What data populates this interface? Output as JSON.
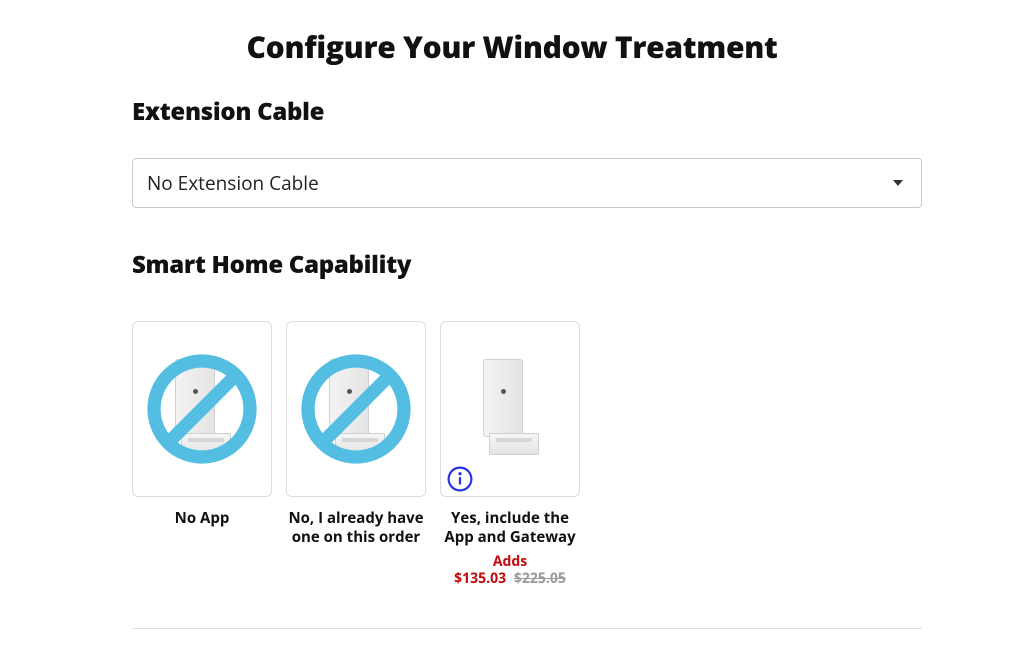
{
  "page_title": "Configure Your Window Treatment",
  "extension": {
    "label": "Extension Cable",
    "selected": "No Extension Cable"
  },
  "smart": {
    "label": "Smart Home Capability",
    "options": [
      {
        "label": "No App",
        "has_slash": true,
        "has_info": false
      },
      {
        "label": "No, I already have one on this order",
        "has_slash": true,
        "has_info": false
      },
      {
        "label": "Yes, include the App and Gateway",
        "has_slash": false,
        "has_info": true,
        "adds_label": "Adds",
        "adds_price": "$135.03",
        "adds_original": "$225.05"
      }
    ]
  }
}
